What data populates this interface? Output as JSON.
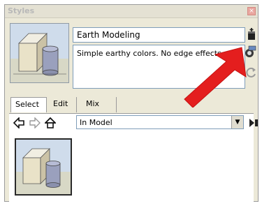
{
  "window": {
    "title": "Styles"
  },
  "style": {
    "name": "Earth Modeling",
    "description": "Simple earthy colors.  No edge effects."
  },
  "tabs": [
    {
      "label": "Select",
      "active": true
    },
    {
      "label": "Edit",
      "active": false
    },
    {
      "label": "Mix",
      "active": false
    }
  ],
  "collection": {
    "selected": "In Model"
  },
  "colors": {
    "arrow": "#e41e1e",
    "field_border": "#7f9db9",
    "panel_bg": "#ece9d8"
  },
  "icons": [
    "close-icon",
    "create-style-icon",
    "update-style-icon",
    "refresh-icon",
    "back-icon",
    "forward-icon",
    "home-icon",
    "dropdown-arrow-icon",
    "details-icon",
    "red-arrow-icon"
  ]
}
